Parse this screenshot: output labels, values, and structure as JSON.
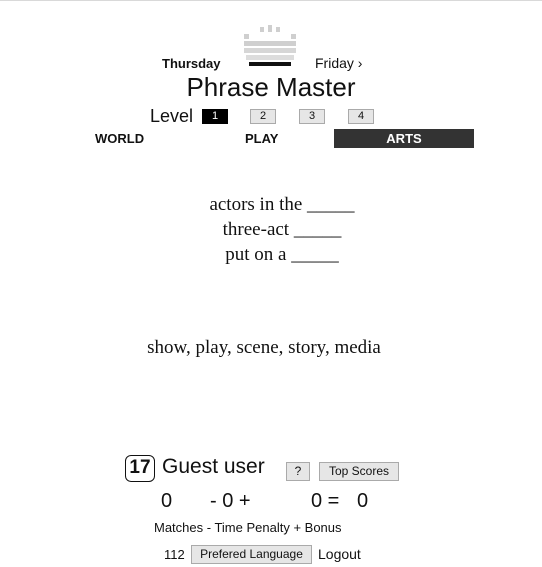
{
  "nav": {
    "prev_day": "Thursday",
    "next_day": "Friday ›"
  },
  "title": "Phrase Master",
  "level": {
    "label": "Level",
    "options": [
      "1",
      "2",
      "3",
      "4"
    ],
    "selected": "1"
  },
  "categories": [
    "WORLD",
    "PLAY",
    "ARTS"
  ],
  "selected_category": "ARTS",
  "clues": [
    "actors in the _____",
    "three-act _____",
    "put on a _____"
  ],
  "answers": "show, play, scene, story, media",
  "player": {
    "score": "17",
    "name": "Guest user",
    "help_label": "?",
    "top_scores_label": "Top Scores"
  },
  "tally": {
    "matches": "0",
    "minus": "- 0 +",
    "bonus": "0 =",
    "total": "0",
    "caption": "Matches - Time Penalty + Bonus"
  },
  "footer": {
    "count": "112",
    "language_label": "Prefered Language",
    "logout_label": "Logout"
  },
  "colors": {
    "accent": "#333333",
    "selected_level": "#000000",
    "logo": "#cccccc"
  }
}
